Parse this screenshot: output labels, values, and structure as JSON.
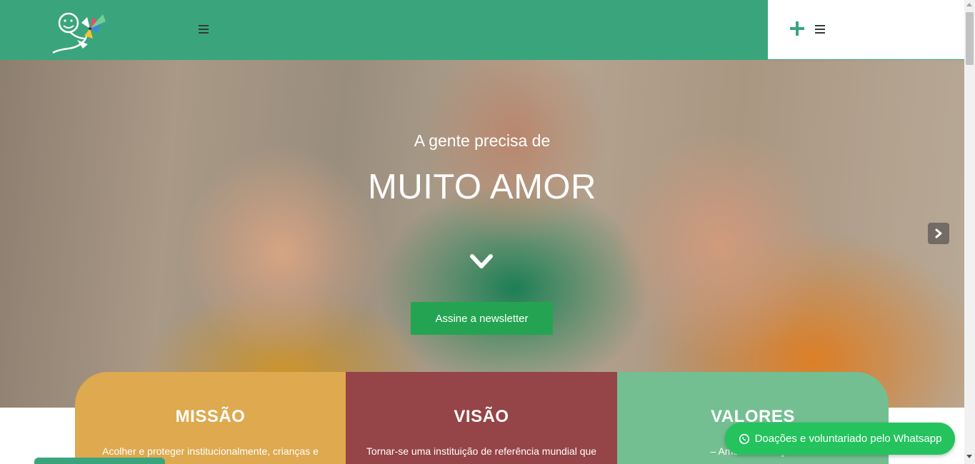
{
  "header": {
    "logo_icon": "child-with-pinwheel-logo-icon",
    "menu_icon": "hamburger-icon",
    "plus_icon": "plus-icon",
    "brand_color": "#3aa57d"
  },
  "hero": {
    "subtitle": "A gente precisa de",
    "title": "MUITO AMOR",
    "scroll_icon": "chevron-down-icon",
    "cta_label": "Assine a newsletter",
    "next_icon": "chevron-right-icon",
    "cta_color": "#24a452"
  },
  "cards": [
    {
      "title": "MISSÃO",
      "text": "Acolher e proteger institucionalmente, crianças e",
      "color": "#dea94f"
    },
    {
      "title": "VISÃO",
      "text": "Tornar-se uma instituição de referência mundial que",
      "color": "#954447"
    },
    {
      "title": "VALORES",
      "text": "– Amor às crianças",
      "color": "#74bf91"
    }
  ],
  "whatsapp": {
    "label": "Doações e voluntariado pelo Whatsapp",
    "icon": "whatsapp-icon",
    "color": "#24c35e"
  }
}
